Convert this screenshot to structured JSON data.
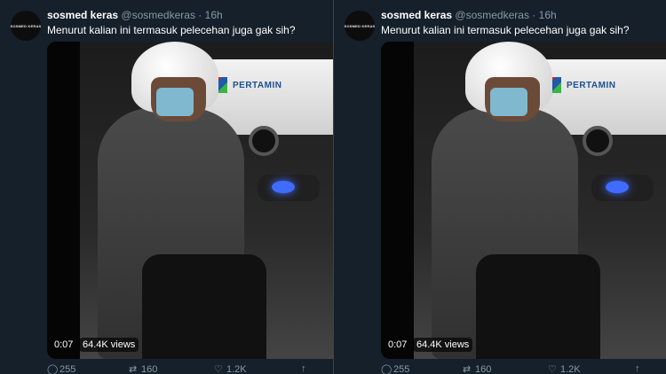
{
  "tweet": {
    "avatar_text": "SOSMED KERAS",
    "display_name": "sosmed keras",
    "handle": "@sosmedkeras",
    "separator": "·",
    "time": "16h",
    "text": "Menurut kalian ini termasuk pelecehan juga gak sih?"
  },
  "media": {
    "duration": "0:07",
    "views": "64.4K views",
    "truck_text": "PERTAMIN"
  },
  "actions": {
    "reply_icon": "reply-icon",
    "reply_count": "255",
    "retweet_icon": "retweet-icon",
    "retweet_count": "160",
    "like_icon": "heart-icon",
    "like_count": "1.2K",
    "share_icon": "share-icon"
  },
  "colors": {
    "background": "#15202b",
    "secondary_text": "#8899a6",
    "primary_text": "#ffffff"
  }
}
